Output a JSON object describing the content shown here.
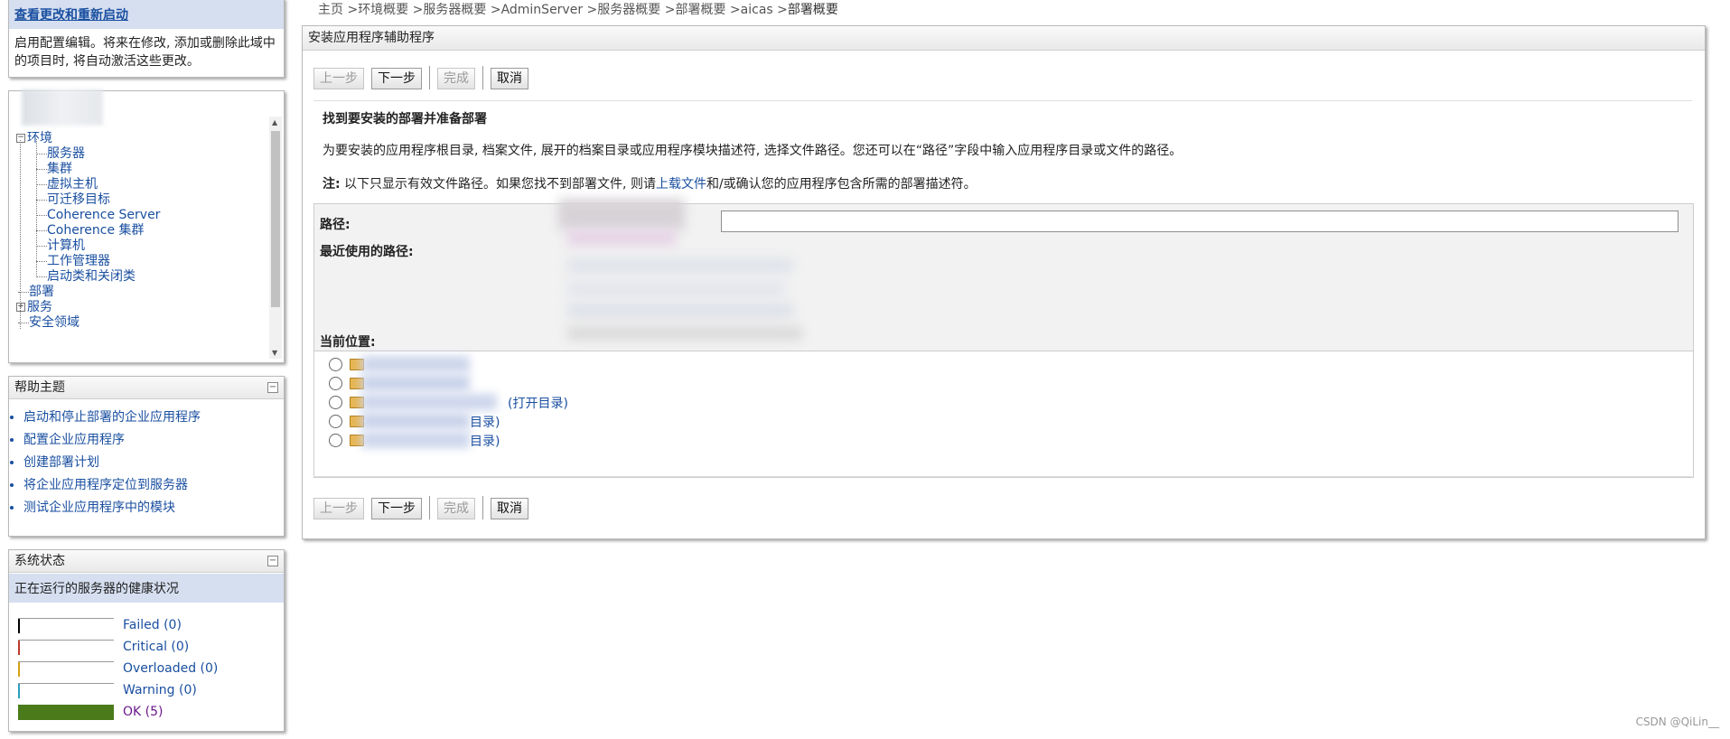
{
  "change_center": {
    "link": "查看更改和重新启动",
    "description": "启用配置编辑。将来在修改, 添加或删除此域中的项目时, 将自动激活这些更改。"
  },
  "domain_structure": {
    "tree": [
      {
        "label": "环境",
        "expand": "−",
        "children": [
          "服务器",
          "集群",
          "虚拟主机",
          "可迁移目标",
          "Coherence Server",
          "Coherence 集群",
          "计算机",
          "工作管理器",
          "启动类和关闭类"
        ]
      },
      {
        "label": "部署"
      },
      {
        "label": "服务",
        "expand": "+"
      },
      {
        "label": "安全领域"
      }
    ]
  },
  "help": {
    "title": "帮助主题",
    "items": [
      "启动和停止部署的企业应用程序",
      "配置企业应用程序",
      "创建部署计划",
      "将企业应用程序定位到服务器",
      "测试企业应用程序中的模块"
    ]
  },
  "system_status": {
    "title": "系统状态",
    "subtitle": "正在运行的服务器的健康状况",
    "rows": [
      {
        "label": "Failed (0)",
        "color": "#000000",
        "fill": 0
      },
      {
        "label": "Critical (0)",
        "color": "#c0392b",
        "fill": 0
      },
      {
        "label": "Overloaded (0)",
        "color": "#d4a017",
        "fill": 0
      },
      {
        "label": "Warning (0)",
        "color": "#2a9fbf",
        "fill": 0
      },
      {
        "label": "OK (5)",
        "color": "#4a7a1a",
        "fill": 1
      }
    ]
  },
  "breadcrumb": {
    "items": [
      "主页",
      "环境概要",
      "服务器概要",
      "AdminServer",
      "服务器概要",
      "部署概要",
      "aicas"
    ],
    "current": "部署概要",
    "sep": " >"
  },
  "wizard": {
    "title": "安装应用程序辅助程序",
    "buttons": {
      "back": "上一步",
      "next": "下一步",
      "finish": "完成",
      "cancel": "取消"
    },
    "section_title": "找到要安装的部署并准备部署",
    "instruction": "为要安装的应用程序根目录, 档案文件, 展开的档案目录或应用程序模块描述符, 选择文件路径。您还可以在“路径”字段中输入应用程序目录或文件的路径。",
    "note_label": "注:",
    "note_pre": " 以下只显示有效文件路径。如果您找不到部署文件, 则请",
    "note_link": "上载文件",
    "note_post": "和/或确认您的应用程序包含所需的部署描述符。",
    "path_label": "路径:",
    "recent_label": "最近使用的路径:",
    "location_label": "当前位置:",
    "locations": [
      {
        "tail": ""
      },
      {
        "tail": ""
      },
      {
        "tail": "(打开目录)"
      },
      {
        "tail": "目录)"
      },
      {
        "tail": "目录)"
      }
    ]
  },
  "watermark": "CSDN @QiLin__"
}
